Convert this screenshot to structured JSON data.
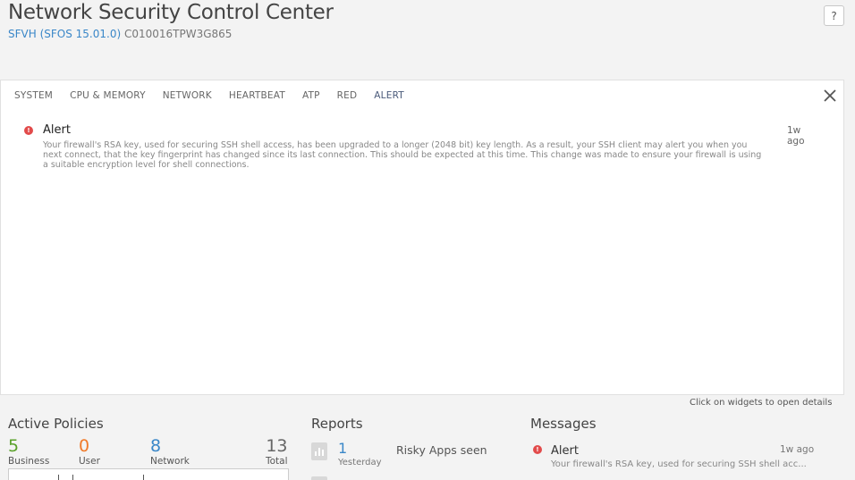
{
  "header": {
    "title": "Network Security Control Center",
    "model": "SFVH (SFOS 15.01.0)",
    "serial": "C010016TPW3G865",
    "help_label": "?"
  },
  "panel": {
    "tabs": [
      {
        "label": "SYSTEM"
      },
      {
        "label": "CPU & MEMORY"
      },
      {
        "label": "NETWORK"
      },
      {
        "label": "HEARTBEAT"
      },
      {
        "label": "ATP"
      },
      {
        "label": "RED"
      },
      {
        "label": "ALERT",
        "active": true
      }
    ],
    "close_icon": "close-icon",
    "alert": {
      "icon": "exclamation",
      "title": "Alert",
      "time": "1w ago",
      "body": "Your firewall's RSA key, used for securing SSH shell access, has been upgraded to a longer (2048 bit) key length. As a result, your SSH client may alert you when you next connect, that the key fingerprint has changed since its last connection. This should be expected at this time. This change was made to ensure your firewall is using a suitable encryption level for shell connections."
    }
  },
  "hint": "Click on widgets to open details",
  "widgets": {
    "policies": {
      "title": "Active Policies",
      "business": {
        "value": "5",
        "label": "Business"
      },
      "user": {
        "value": "0",
        "label": "User"
      },
      "network": {
        "value": "8",
        "label": "Network"
      },
      "total": {
        "value": "13",
        "label": "Total"
      }
    },
    "reports": {
      "title": "Reports",
      "item": {
        "value": "1",
        "sub": "Yesterday",
        "label": "Risky Apps seen"
      }
    },
    "messages": {
      "title": "Messages",
      "item": {
        "title": "Alert",
        "time": "1w ago",
        "body": "Your firewall's RSA key, used for securing SSH shell acc..."
      }
    }
  },
  "colors": {
    "accent": "#3a87c8",
    "business": "#5aa12a",
    "user": "#f07a2a",
    "alert": "#e24b4b"
  }
}
